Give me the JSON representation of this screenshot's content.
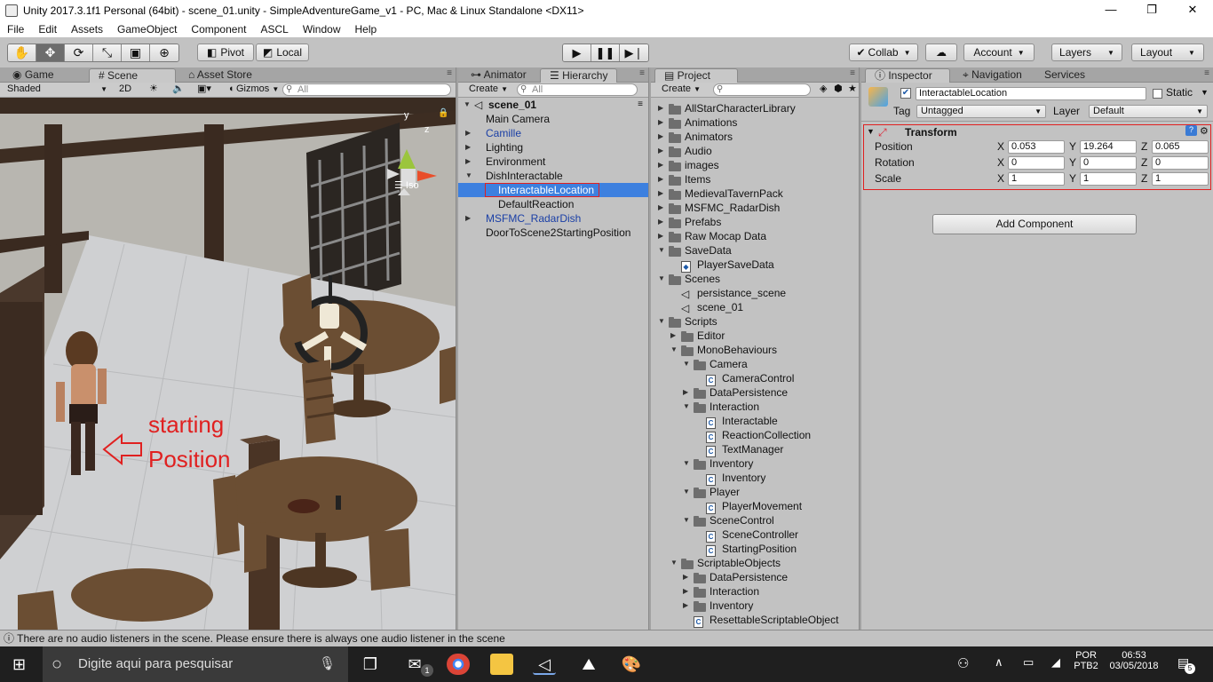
{
  "window": {
    "title": "Unity 2017.3.1f1 Personal (64bit) - scene_01.unity - SimpleAdventureGame_v1 - PC, Mac & Linux Standalone <DX11>",
    "minimize": "—",
    "maximize": "❐",
    "close": "✕"
  },
  "menu": [
    "File",
    "Edit",
    "Assets",
    "GameObject",
    "Component",
    "ASCL",
    "Window",
    "Help"
  ],
  "toolbar": {
    "pivot": "Pivot",
    "local": "Local",
    "collab": "Collab",
    "account": "Account",
    "layers": "Layers",
    "layout": "Layout"
  },
  "scene_panel": {
    "tabs": [
      "Game",
      "Scene",
      "Asset Store"
    ],
    "shading": "Shaded",
    "mode_2d": "2D",
    "gizmos": "Gizmos",
    "search_placeholder": "All",
    "gizmo_y": "y",
    "gizmo_z": "z",
    "gizmo_mode": "Iso",
    "annotation_line1": "starting",
    "annotation_line2": "Position"
  },
  "hierarchy": {
    "tabs": [
      "Animator",
      "Hierarchy"
    ],
    "create": "Create",
    "search_placeholder": "All",
    "scene_name": "scene_01",
    "items": [
      {
        "label": "Main Camera",
        "indent": 0,
        "arrow": "",
        "prefab": false,
        "selected": false
      },
      {
        "label": "Camille",
        "indent": 0,
        "arrow": "▶",
        "prefab": true,
        "selected": false
      },
      {
        "label": "Lighting",
        "indent": 0,
        "arrow": "▶",
        "prefab": false,
        "selected": false
      },
      {
        "label": "Environment",
        "indent": 0,
        "arrow": "▶",
        "prefab": false,
        "selected": false
      },
      {
        "label": "DishInteractable",
        "indent": 0,
        "arrow": "▼",
        "prefab": false,
        "selected": false
      },
      {
        "label": "InteractableLocation",
        "indent": 1,
        "arrow": "",
        "prefab": false,
        "selected": true
      },
      {
        "label": "DefaultReaction",
        "indent": 1,
        "arrow": "",
        "prefab": false,
        "selected": false
      },
      {
        "label": "MSFMC_RadarDish",
        "indent": 0,
        "arrow": "▶",
        "prefab": true,
        "selected": false
      },
      {
        "label": "DoorToScene2StartingPosition",
        "indent": 0,
        "arrow": "",
        "prefab": false,
        "selected": false
      }
    ]
  },
  "project": {
    "tab": "Project",
    "create": "Create",
    "items": [
      {
        "label": "AllStarCharacterLibrary",
        "indent": 0,
        "arrow": "▶",
        "icon": "folder"
      },
      {
        "label": "Animations",
        "indent": 0,
        "arrow": "▶",
        "icon": "folder"
      },
      {
        "label": "Animators",
        "indent": 0,
        "arrow": "▶",
        "icon": "folder"
      },
      {
        "label": "Audio",
        "indent": 0,
        "arrow": "▶",
        "icon": "folder"
      },
      {
        "label": "images",
        "indent": 0,
        "arrow": "▶",
        "icon": "folder"
      },
      {
        "label": "Items",
        "indent": 0,
        "arrow": "▶",
        "icon": "folder"
      },
      {
        "label": "MedievalTavernPack",
        "indent": 0,
        "arrow": "▶",
        "icon": "folder"
      },
      {
        "label": "MSFMC_RadarDish",
        "indent": 0,
        "arrow": "▶",
        "icon": "folder"
      },
      {
        "label": "Prefabs",
        "indent": 0,
        "arrow": "▶",
        "icon": "folder"
      },
      {
        "label": "Raw Mocap Data",
        "indent": 0,
        "arrow": "▶",
        "icon": "folder"
      },
      {
        "label": "SaveData",
        "indent": 0,
        "arrow": "▼",
        "icon": "folder"
      },
      {
        "label": "PlayerSaveData",
        "indent": 1,
        "arrow": "",
        "icon": "asset"
      },
      {
        "label": "Scenes",
        "indent": 0,
        "arrow": "▼",
        "icon": "folder"
      },
      {
        "label": "persistance_scene",
        "indent": 1,
        "arrow": "",
        "icon": "scene"
      },
      {
        "label": "scene_01",
        "indent": 1,
        "arrow": "",
        "icon": "scene"
      },
      {
        "label": "Scripts",
        "indent": 0,
        "arrow": "▼",
        "icon": "folder"
      },
      {
        "label": "Editor",
        "indent": 1,
        "arrow": "▶",
        "icon": "folder"
      },
      {
        "label": "MonoBehaviours",
        "indent": 1,
        "arrow": "▼",
        "icon": "folder"
      },
      {
        "label": "Camera",
        "indent": 2,
        "arrow": "▼",
        "icon": "folder"
      },
      {
        "label": "CameraControl",
        "indent": 3,
        "arrow": "",
        "icon": "script"
      },
      {
        "label": "DataPersistence",
        "indent": 2,
        "arrow": "▶",
        "icon": "folder"
      },
      {
        "label": "Interaction",
        "indent": 2,
        "arrow": "▼",
        "icon": "folder"
      },
      {
        "label": "Interactable",
        "indent": 3,
        "arrow": "",
        "icon": "script"
      },
      {
        "label": "ReactionCollection",
        "indent": 3,
        "arrow": "",
        "icon": "script"
      },
      {
        "label": "TextManager",
        "indent": 3,
        "arrow": "",
        "icon": "script"
      },
      {
        "label": "Inventory",
        "indent": 2,
        "arrow": "▼",
        "icon": "folder"
      },
      {
        "label": "Inventory",
        "indent": 3,
        "arrow": "",
        "icon": "script"
      },
      {
        "label": "Player",
        "indent": 2,
        "arrow": "▼",
        "icon": "folder"
      },
      {
        "label": "PlayerMovement",
        "indent": 3,
        "arrow": "",
        "icon": "script"
      },
      {
        "label": "SceneControl",
        "indent": 2,
        "arrow": "▼",
        "icon": "folder"
      },
      {
        "label": "SceneController",
        "indent": 3,
        "arrow": "",
        "icon": "script"
      },
      {
        "label": "StartingPosition",
        "indent": 3,
        "arrow": "",
        "icon": "script"
      },
      {
        "label": "ScriptableObjects",
        "indent": 1,
        "arrow": "▼",
        "icon": "folder"
      },
      {
        "label": "DataPersistence",
        "indent": 2,
        "arrow": "▶",
        "icon": "folder"
      },
      {
        "label": "Interaction",
        "indent": 2,
        "arrow": "▶",
        "icon": "folder"
      },
      {
        "label": "Inventory",
        "indent": 2,
        "arrow": "▶",
        "icon": "folder"
      },
      {
        "label": "ResettableScriptableObject",
        "indent": 2,
        "arrow": "",
        "icon": "script"
      }
    ]
  },
  "inspector": {
    "tabs": [
      "Inspector",
      "Navigation",
      "Services"
    ],
    "object_name": "InteractableLocation",
    "static_label": "Static",
    "tag_label": "Tag",
    "tag_value": "Untagged",
    "layer_label": "Layer",
    "layer_value": "Default",
    "transform_title": "Transform",
    "rows": [
      {
        "label": "Position",
        "x": "0.053",
        "y": "19.264",
        "z": "0.065"
      },
      {
        "label": "Rotation",
        "x": "0",
        "y": "0",
        "z": "0"
      },
      {
        "label": "Scale",
        "x": "1",
        "y": "1",
        "z": "1"
      }
    ],
    "axis_x": "X",
    "axis_y": "Y",
    "axis_z": "Z",
    "add_component": "Add Component"
  },
  "status": {
    "message": "There are no audio listeners in the scene. Please ensure there is always one audio listener in the scene"
  },
  "taskbar": {
    "search_placeholder": "Digite aqui para pesquisar",
    "mail_badge": "1",
    "lang_line1": "POR",
    "lang_line2": "PTB2",
    "time": "06:53",
    "date": "03/05/2018",
    "notif_count": "5"
  },
  "colors": {
    "selection": "#3d80df",
    "highlight_red": "#e02020",
    "prefab_blue": "#1a3fa6"
  }
}
